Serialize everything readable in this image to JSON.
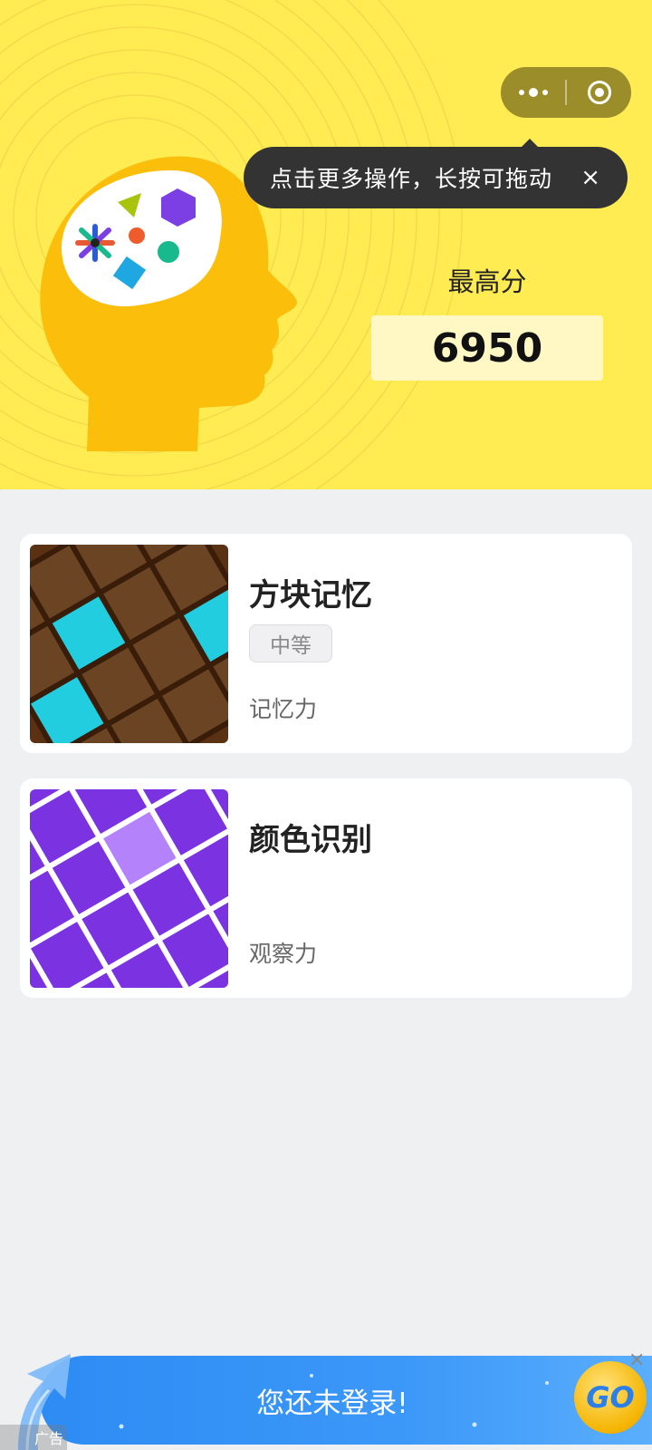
{
  "capsule": {
    "more_icon": "more-dots-icon",
    "close_icon": "target-close-icon"
  },
  "tooltip": {
    "text": "点击更多操作，长按可拖动",
    "close_icon": "×"
  },
  "hero": {
    "score_label": "最高分",
    "score_value": "6950",
    "background_color": "#ffeb52"
  },
  "games": [
    {
      "title": "方块记忆",
      "difficulty": "中等",
      "skill": "记忆力",
      "thumb_colors": {
        "bg": "#5a3112",
        "tile": "#6b4423",
        "highlight": "#22cddf"
      }
    },
    {
      "title": "颜色识别",
      "difficulty": "",
      "skill": "观察力",
      "thumb_colors": {
        "bg": "#7b32e0",
        "tile": "#7b32e0",
        "highlight": "#b482fb"
      }
    }
  ],
  "ad": {
    "text": "您还未登录!",
    "go_label": "GO",
    "close_icon": "×",
    "ad_label": "广告"
  }
}
